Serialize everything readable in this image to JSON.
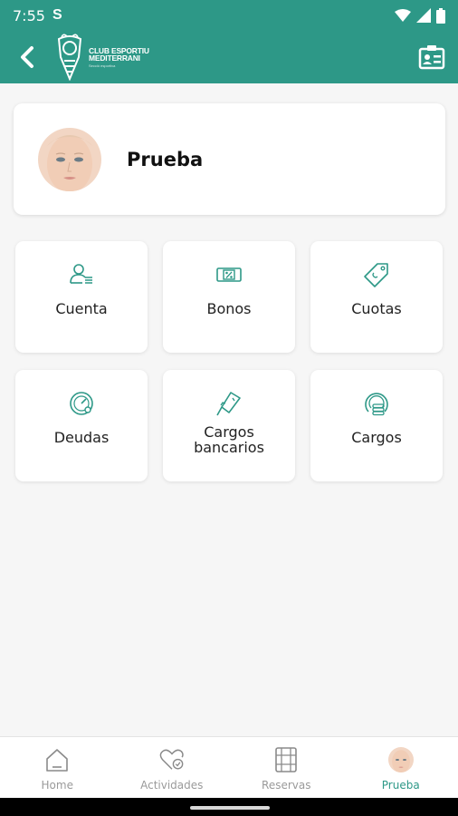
{
  "status_bar": {
    "time": "7:55",
    "s_icon": "S"
  },
  "app_bar": {
    "logo_line1": "CLUB ESPORTIU",
    "logo_line2": "MEDITERRANI",
    "logo_line3": "Secció esportiva",
    "accent": "#2d9887"
  },
  "profile": {
    "name": "Prueba"
  },
  "tiles": [
    {
      "label": "Cuenta",
      "icon": "user-list-icon"
    },
    {
      "label": "Bonos",
      "icon": "voucher-percent-icon"
    },
    {
      "label": "Cuotas",
      "icon": "price-tag-icon"
    },
    {
      "label": "Deudas",
      "icon": "speedometer-clock-icon"
    },
    {
      "label_line1": "Cargos",
      "label_line2": "bancarios",
      "icon": "card-swipe-icon"
    },
    {
      "label": "Cargos",
      "icon": "coins-charge-icon"
    }
  ],
  "bottom_nav": [
    {
      "label": "Home",
      "icon": "home-icon"
    },
    {
      "label": "Actividades",
      "icon": "heart-check-icon"
    },
    {
      "label": "Reservas",
      "icon": "calendar-grid-icon"
    },
    {
      "label": "Prueba",
      "icon": "avatar",
      "active": true
    }
  ]
}
